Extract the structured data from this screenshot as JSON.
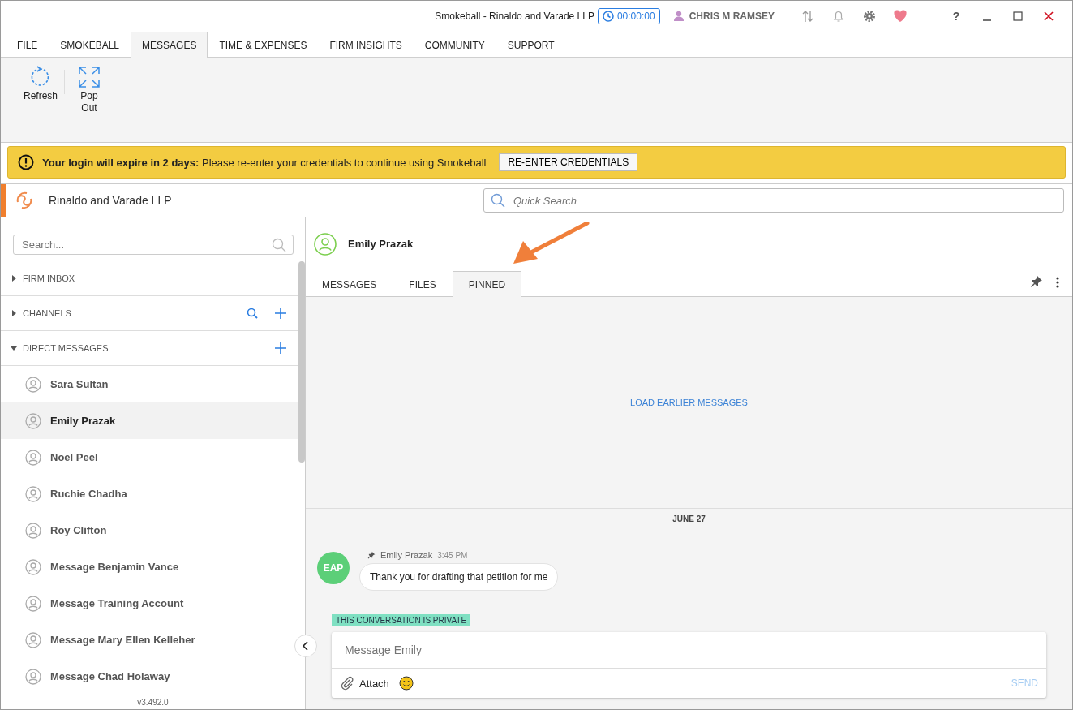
{
  "window": {
    "title": "Smokeball  - Rinaldo and Varade LLP",
    "timer": "00:00:00",
    "user": "CHRIS M RAMSEY",
    "help": "?"
  },
  "menu": [
    {
      "label": "FILE",
      "selected": false
    },
    {
      "label": "SMOKEBALL",
      "selected": false
    },
    {
      "label": "MESSAGES",
      "selected": true
    },
    {
      "label": "TIME & EXPENSES",
      "selected": false
    },
    {
      "label": "FIRM INSIGHTS",
      "selected": false
    },
    {
      "label": "COMMUNITY",
      "selected": false
    },
    {
      "label": "SUPPORT",
      "selected": false
    }
  ],
  "ribbon": [
    {
      "label": "Refresh",
      "kind": "refresh"
    },
    {
      "label": "Pop Out",
      "kind": "popout"
    }
  ],
  "banner": {
    "text": "**Your login will expire in 2 days:** Please re-enter your credentials to continue using Smokeball",
    "button": "RE-ENTER CREDENTIALS"
  },
  "firm": {
    "name": "Rinaldo and Varade LLP",
    "search_placeholder": "Quick Search"
  },
  "sidebar": {
    "search_placeholder": "Search...",
    "sections": [
      {
        "label": "FIRM INBOX",
        "expanded": false,
        "kind": "inbox"
      },
      {
        "label": "CHANNELS",
        "expanded": false,
        "kind": "channels"
      },
      {
        "label": "DIRECT MESSAGES",
        "expanded": true,
        "kind": "direct"
      }
    ],
    "contacts": [
      {
        "name": "Sara Sultan",
        "selected": false
      },
      {
        "name": "Emily Prazak",
        "selected": true
      },
      {
        "name": "Noel Peel",
        "selected": false
      },
      {
        "name": "Ruchie Chadha",
        "selected": false
      },
      {
        "name": "Roy Clifton",
        "selected": false
      },
      {
        "name": "Message Benjamin Vance",
        "selected": false
      },
      {
        "name": "Message Training Account",
        "selected": false
      },
      {
        "name": "Message Mary Ellen Kelleher",
        "selected": false
      },
      {
        "name": "Message Chad Holaway",
        "selected": false
      }
    ],
    "version": "v3.492.0"
  },
  "chat": {
    "contact": "Emily Prazak",
    "tabs": [
      {
        "label": "MESSAGES",
        "selected": false
      },
      {
        "label": "FILES",
        "selected": false
      },
      {
        "label": "PINNED",
        "selected": true
      }
    ],
    "load_earlier": "LOAD EARLIER MESSAGES",
    "date": "JUNE 27",
    "messages": [
      {
        "initials": "EAP",
        "author": "Emily Prazak",
        "time": "3:45 PM",
        "text": "Thank you for drafting that petition for me",
        "pinned": true
      }
    ],
    "privacy": "THIS CONVERSATION IS PRIVATE",
    "composer": {
      "placeholder": "Message Emily",
      "attach": "Attach",
      "send": "SEND"
    }
  }
}
